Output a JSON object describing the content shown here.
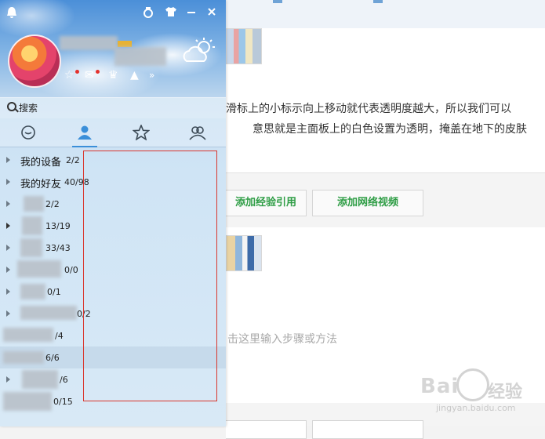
{
  "background": {
    "text_line1": "滑标上的小标示向上移动就代表透明度越大，所以我们可以",
    "text_line2": "意思就是主面板上的白色设置为透明，掩盖在地下的皮肤",
    "btn_add_ref": "添加经验引用",
    "btn_add_video": "添加网络视频",
    "step_placeholder": "击这里输入步骤或方法",
    "watermark_brand": "Bai",
    "watermark_cn": "经验",
    "watermark_url": "jingyan.baidu.com"
  },
  "qq": {
    "search_placeholder": "搜索",
    "tabs": [
      {
        "name": "chat",
        "icon": "chat-bubble-icon",
        "active": false
      },
      {
        "name": "contacts",
        "icon": "person-icon",
        "active": true
      },
      {
        "name": "favorites",
        "icon": "star-icon",
        "active": false
      },
      {
        "name": "groups",
        "icon": "group-icon",
        "active": false
      }
    ],
    "groups": [
      {
        "label": "我的设备",
        "count": "2/2"
      },
      {
        "label": "我的好友",
        "count": "40/98"
      },
      {
        "label": "",
        "count": "2/2"
      },
      {
        "label": "",
        "count": "13/19"
      },
      {
        "label": "",
        "count": "33/43"
      },
      {
        "label": "",
        "count": "0/0"
      },
      {
        "label": "",
        "count": "0/1"
      },
      {
        "label": "",
        "count": "0/2"
      },
      {
        "label": "",
        "count": "/4"
      },
      {
        "label": "",
        "count": "6/6"
      },
      {
        "label": "",
        "count": "/6"
      },
      {
        "label": "",
        "count": "0/15"
      }
    ],
    "colors": {
      "accent": "#3b8fd9",
      "red_box": "#d9362d"
    }
  }
}
